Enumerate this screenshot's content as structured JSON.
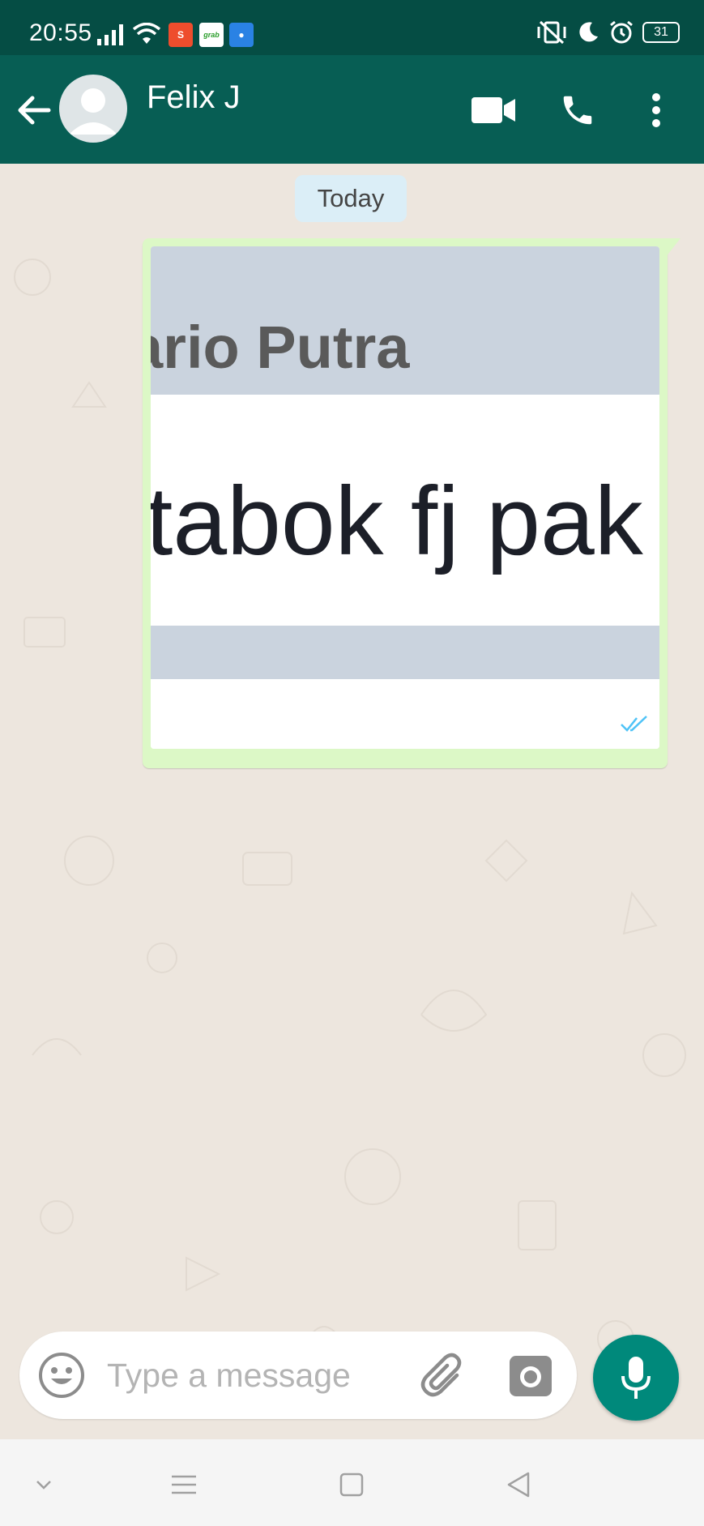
{
  "status_bar": {
    "time": "20:55",
    "battery": "31",
    "app_icons": [
      "shopee-icon",
      "grab-icon",
      "message-app-icon"
    ]
  },
  "header": {
    "contact_name": "Felix J",
    "icons": [
      "back-arrow-icon",
      "avatar",
      "video-call-icon",
      "phone-icon",
      "more-vert-icon"
    ]
  },
  "chat": {
    "date_chip": "Today",
    "messages": [
      {
        "type": "image",
        "outgoing": true,
        "image_text_name": "ario Putra",
        "image_text_message": "tabok fj pak",
        "status": "read"
      }
    ]
  },
  "composer": {
    "placeholder": "Type a message"
  },
  "colors": {
    "header": "#075e54",
    "status_bar": "#054d44",
    "bubble_out": "#dcf8c6",
    "accent": "#00897b",
    "read_ticks": "#4fc3f7"
  }
}
